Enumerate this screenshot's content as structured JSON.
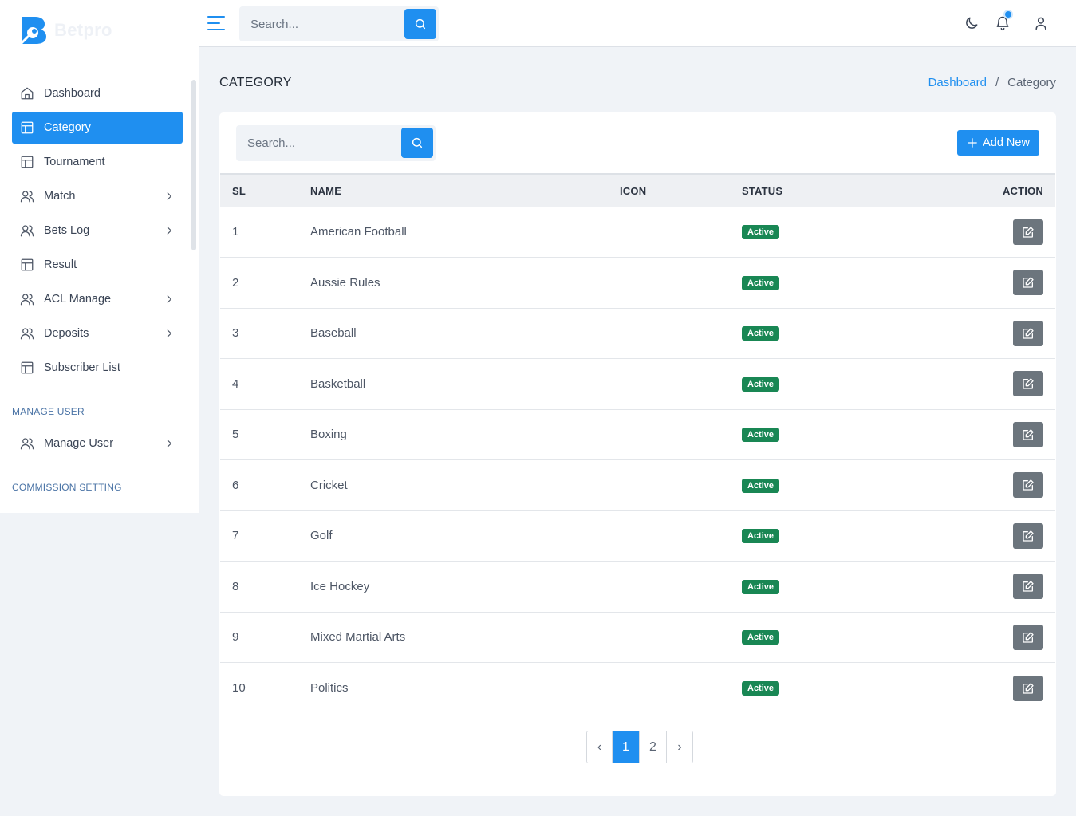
{
  "brand": {
    "name": "Betpro",
    "logo_letter": "B"
  },
  "sidebar": {
    "items": [
      {
        "label": "Dashboard",
        "icon": "home-icon",
        "active": false,
        "has_submenu": false
      },
      {
        "label": "Category",
        "icon": "table-icon",
        "active": true,
        "has_submenu": false
      },
      {
        "label": "Tournament",
        "icon": "table-icon",
        "active": false,
        "has_submenu": false
      },
      {
        "label": "Match",
        "icon": "users-icon",
        "active": false,
        "has_submenu": true
      },
      {
        "label": "Bets Log",
        "icon": "users-icon",
        "active": false,
        "has_submenu": true
      },
      {
        "label": "Result",
        "icon": "table-icon",
        "active": false,
        "has_submenu": false
      },
      {
        "label": "ACL Manage",
        "icon": "users-icon",
        "active": false,
        "has_submenu": true
      },
      {
        "label": "Deposits",
        "icon": "users-icon",
        "active": false,
        "has_submenu": true
      },
      {
        "label": "Subscriber List",
        "icon": "table-icon",
        "active": false,
        "has_submenu": false
      }
    ],
    "section_manage_user": "MANAGE USER",
    "manage_user_item": {
      "label": "Manage User",
      "icon": "users-icon",
      "has_submenu": true
    },
    "section_commission": "COMMISSION SETTING"
  },
  "header": {
    "search_placeholder": "Search...",
    "icons": [
      "moon-icon",
      "bell-icon",
      "user-icon"
    ]
  },
  "page": {
    "title": "CATEGORY",
    "breadcrumb": {
      "home": "Dashboard",
      "separator": "/",
      "current": "Category"
    }
  },
  "card": {
    "search_placeholder": "Search...",
    "add_button": "Add New"
  },
  "table": {
    "headers": {
      "sl": "SL",
      "name": "NAME",
      "icon": "ICON",
      "status": "STATUS",
      "action": "ACTION"
    },
    "rows": [
      {
        "sl": "1",
        "name": "American Football",
        "status": "Active"
      },
      {
        "sl": "2",
        "name": "Aussie Rules",
        "status": "Active"
      },
      {
        "sl": "3",
        "name": "Baseball",
        "status": "Active"
      },
      {
        "sl": "4",
        "name": "Basketball",
        "status": "Active"
      },
      {
        "sl": "5",
        "name": "Boxing",
        "status": "Active"
      },
      {
        "sl": "6",
        "name": "Cricket",
        "status": "Active"
      },
      {
        "sl": "7",
        "name": "Golf",
        "status": "Active"
      },
      {
        "sl": "8",
        "name": "Ice Hockey",
        "status": "Active"
      },
      {
        "sl": "9",
        "name": "Mixed Martial Arts",
        "status": "Active"
      },
      {
        "sl": "10",
        "name": "Politics",
        "status": "Active"
      }
    ]
  },
  "pagination": {
    "prev": "‹",
    "pages": [
      "1",
      "2"
    ],
    "current": "1",
    "next": "›"
  },
  "colors": {
    "primary": "#1f8ff0",
    "success": "#198754",
    "secondary": "#6c757d",
    "background": "#f0f3f7"
  }
}
